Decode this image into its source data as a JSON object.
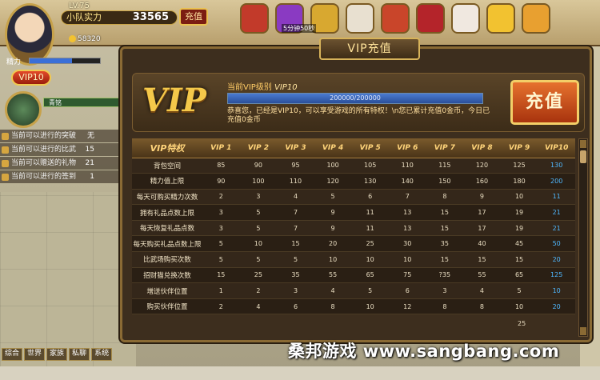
{
  "player": {
    "level": "LV.75",
    "power_label": "小队实力",
    "power_value": "33565",
    "recharge_label": "充值",
    "gold": "58320",
    "stamina_label": "精力",
    "vip_badge": "VIP10",
    "pet_label": "青铭"
  },
  "timer": "5分钟50秒",
  "tasks": [
    {
      "label": "当前可以进行的突破",
      "count": "无"
    },
    {
      "label": "当前可以进行的比武",
      "count": "15"
    },
    {
      "label": "当前可以赠送的礼物",
      "count": "21"
    },
    {
      "label": "当前可以进行的签到",
      "count": "1"
    }
  ],
  "chat_tabs": [
    "综合",
    "世界",
    "家族",
    "私聊",
    "系统"
  ],
  "panel": {
    "title": "VIP充值",
    "vip_logo": "VIP",
    "level_label": "当前VIP级别",
    "level_value": "VIP10",
    "progress_text": "200000/200000",
    "progress": 1.0,
    "message": "恭喜您，已经是VIP10，可以享受游戏的所有特权！\\n您已累计充值0金币，今日已充值0金币",
    "recharge_button": "充值"
  },
  "table": {
    "headers": [
      "VIP特权",
      "VIP 1",
      "VIP 2",
      "VIP 3",
      "VIP 4",
      "VIP 5",
      "VIP 6",
      "VIP 7",
      "VIP 8",
      "VIP 9",
      "VIP10"
    ],
    "rows": [
      [
        "背包空间",
        "85",
        "90",
        "95",
        "100",
        "105",
        "110",
        "115",
        "120",
        "125",
        "130"
      ],
      [
        "精力值上限",
        "90",
        "100",
        "110",
        "120",
        "130",
        "140",
        "150",
        "160",
        "180",
        "200"
      ],
      [
        "每天可购买精力次数",
        "2",
        "3",
        "4",
        "5",
        "6",
        "7",
        "8",
        "9",
        "10",
        "11"
      ],
      [
        "拥有礼品点数上限",
        "3",
        "5",
        "7",
        "9",
        "11",
        "13",
        "15",
        "17",
        "19",
        "21"
      ],
      [
        "每天恢复礼品点数",
        "3",
        "5",
        "7",
        "9",
        "11",
        "13",
        "15",
        "17",
        "19",
        "21"
      ],
      [
        "每天购买礼品点数上限",
        "5",
        "10",
        "15",
        "20",
        "25",
        "30",
        "35",
        "40",
        "45",
        "50"
      ],
      [
        "比武场购买次数",
        "5",
        "5",
        "5",
        "10",
        "10",
        "10",
        "15",
        "15",
        "15",
        "20"
      ],
      [
        "招财猫兑换次数",
        "15",
        "25",
        "35",
        "55",
        "65",
        "75",
        "?35",
        "55",
        "65",
        "125"
      ],
      [
        "增送伙伴位置",
        "1",
        "2",
        "3",
        "4",
        "5",
        "6",
        "3",
        "4",
        "5",
        "10"
      ],
      [
        "购买伙伴位置",
        "2",
        "4",
        "6",
        "8",
        "10",
        "12",
        "8",
        "8",
        "10",
        "20"
      ]
    ],
    "extra_value": "25"
  },
  "watermark": "桑邦游戏 www.sangbang.com"
}
